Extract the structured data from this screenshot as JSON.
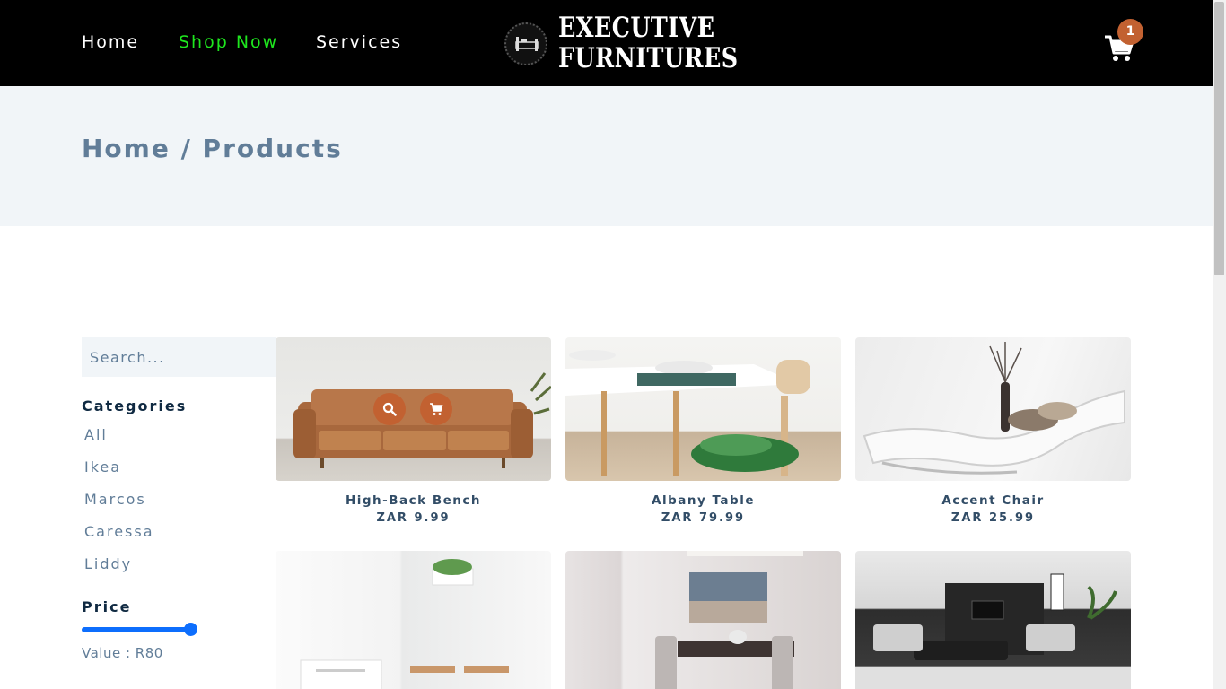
{
  "nav": {
    "links": [
      "Home",
      "Shop Now",
      "Services"
    ],
    "logo_line1": "EXECUTIVE",
    "logo_line2": "FURNITURES",
    "cart_count": "1",
    "active_link": "Shop Now"
  },
  "banner": {
    "breadcrumb": "Home / Products"
  },
  "filters": {
    "search_placeholder": "Search...",
    "categories_heading": "Categories",
    "categories": [
      "All",
      "Ikea",
      "Marcos",
      "Caressa",
      "Liddy"
    ],
    "price_heading": "Price",
    "price_value_text": "Value : R80",
    "price_slider_level": 1.0
  },
  "products": [
    {
      "name": "High-Back Bench",
      "price": "ZAR 9.99"
    },
    {
      "name": "Albany Table",
      "price": "ZAR 79.99"
    },
    {
      "name": "Accent Chair",
      "price": "ZAR 25.99"
    },
    {
      "name": "",
      "price": ""
    },
    {
      "name": "",
      "price": ""
    },
    {
      "name": "",
      "price": ""
    }
  ],
  "colors": {
    "navbar": "#000000",
    "active_link": "#1ee61e",
    "accent": "#c26131",
    "banner_bg": "#f1f5f8",
    "slider": "#0d6efd",
    "text_muted": "#617d98"
  },
  "icons": [
    "bed-logo-icon",
    "cart-icon",
    "search-icon",
    "cart-add-icon"
  ]
}
